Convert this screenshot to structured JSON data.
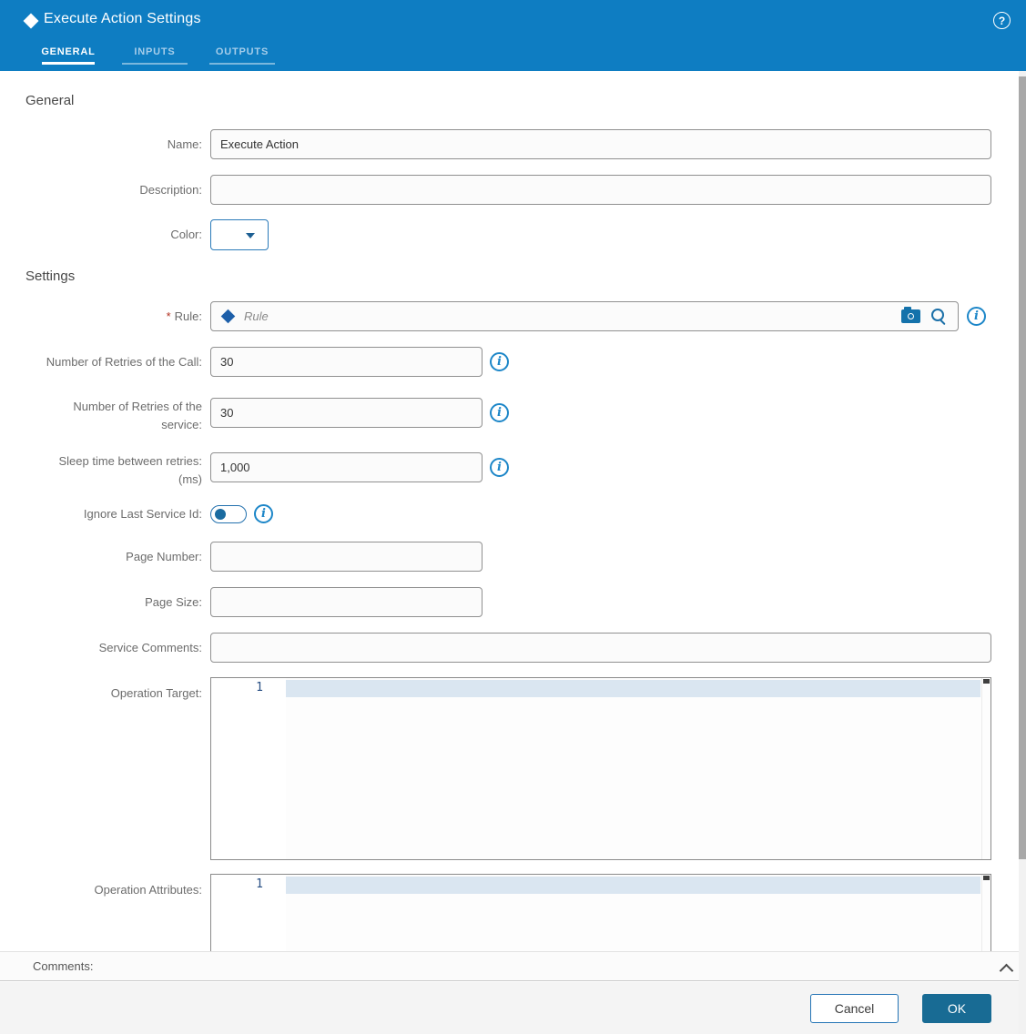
{
  "header": {
    "title": "Execute Action Settings",
    "help_glyph": "?",
    "tabs": {
      "general": "GENERAL",
      "inputs": "INPUTS",
      "outputs": "OUTPUTS"
    }
  },
  "general": {
    "heading": "General",
    "name_label": "Name:",
    "name_value": "Execute Action",
    "description_label": "Description:",
    "description_value": "",
    "color_label": "Color:"
  },
  "settings": {
    "heading": "Settings",
    "required_mark": "*",
    "rule_label": "Rule:",
    "rule_placeholder": "Rule",
    "retries_call_label": "Number of Retries of the Call:",
    "retries_call_value": "30",
    "retries_service_label": "Number of Retries of the service:",
    "retries_service_value": "30",
    "sleep_label": "Sleep time between retries: (ms)",
    "sleep_value": "1,000",
    "ignore_label": "Ignore Last Service Id:",
    "ignore_on": false,
    "page_number_label": "Page Number:",
    "page_number_value": "",
    "page_size_label": "Page Size:",
    "page_size_value": "",
    "service_comments_label": "Service Comments:",
    "service_comments_value": "",
    "operation_target_label": "Operation Target:",
    "operation_target_line_number": "1",
    "operation_attributes_label": "Operation Attributes:",
    "operation_attributes_line_number": "1"
  },
  "icons": {
    "info_glyph": "i"
  },
  "comments": {
    "label": "Comments:"
  },
  "footer": {
    "cancel": "Cancel",
    "ok": "OK"
  },
  "colors": {
    "header_blue": "#0e7dc2",
    "accent_blue": "#2474b5",
    "ok_button_blue": "#186b94",
    "info_icon_blue": "#1c86c8",
    "required_red": "#b23121",
    "active_line_highlight": "#dae6f1"
  }
}
